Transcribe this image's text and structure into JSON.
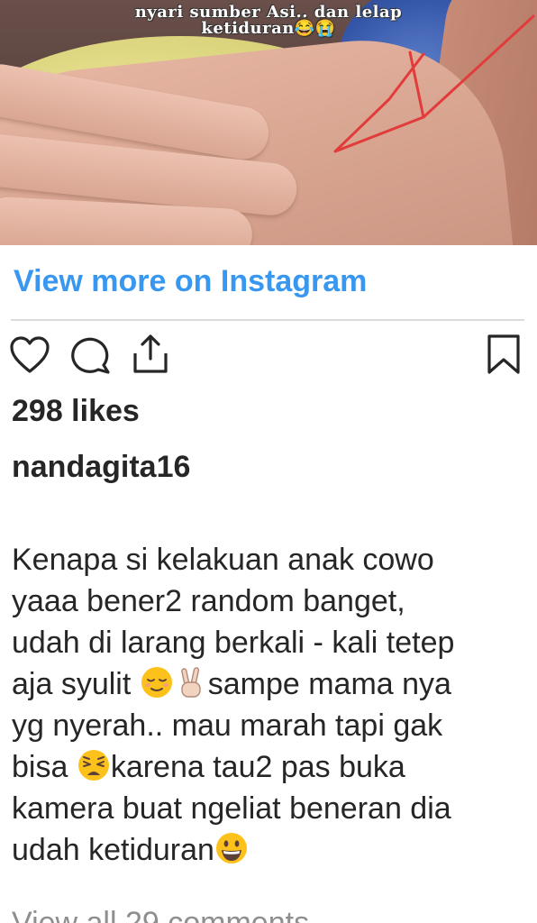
{
  "media": {
    "caption_line1": "nyari sumber Asi.. dan lelap",
    "caption_line2": "ketiduran😂😭"
  },
  "view_more_label": "View more on Instagram",
  "actions": {
    "like_icon": "heart-icon",
    "comment_icon": "comment-icon",
    "share_icon": "share-icon",
    "save_icon": "bookmark-icon"
  },
  "likes": "298 likes",
  "username": "nandagita16",
  "caption": {
    "part1": "Kenapa si kelakuan anak cowo\nyaaa bener2 random banget,\nudah di larang berkali - kali tetep\naja syulit ",
    "part2": "sampe mama nya\nyg nyerah.. mau marah tapi gak\nbisa ",
    "part3": "karena tau2 pas buka\nkamera buat ngeliat beneran dia\nudah ketiduran"
  },
  "view_comments": "View all 29 comments",
  "colors": {
    "link": "#3897f0",
    "text": "#262626",
    "muted": "#8e8e8e",
    "divider": "#dbdbdb"
  }
}
